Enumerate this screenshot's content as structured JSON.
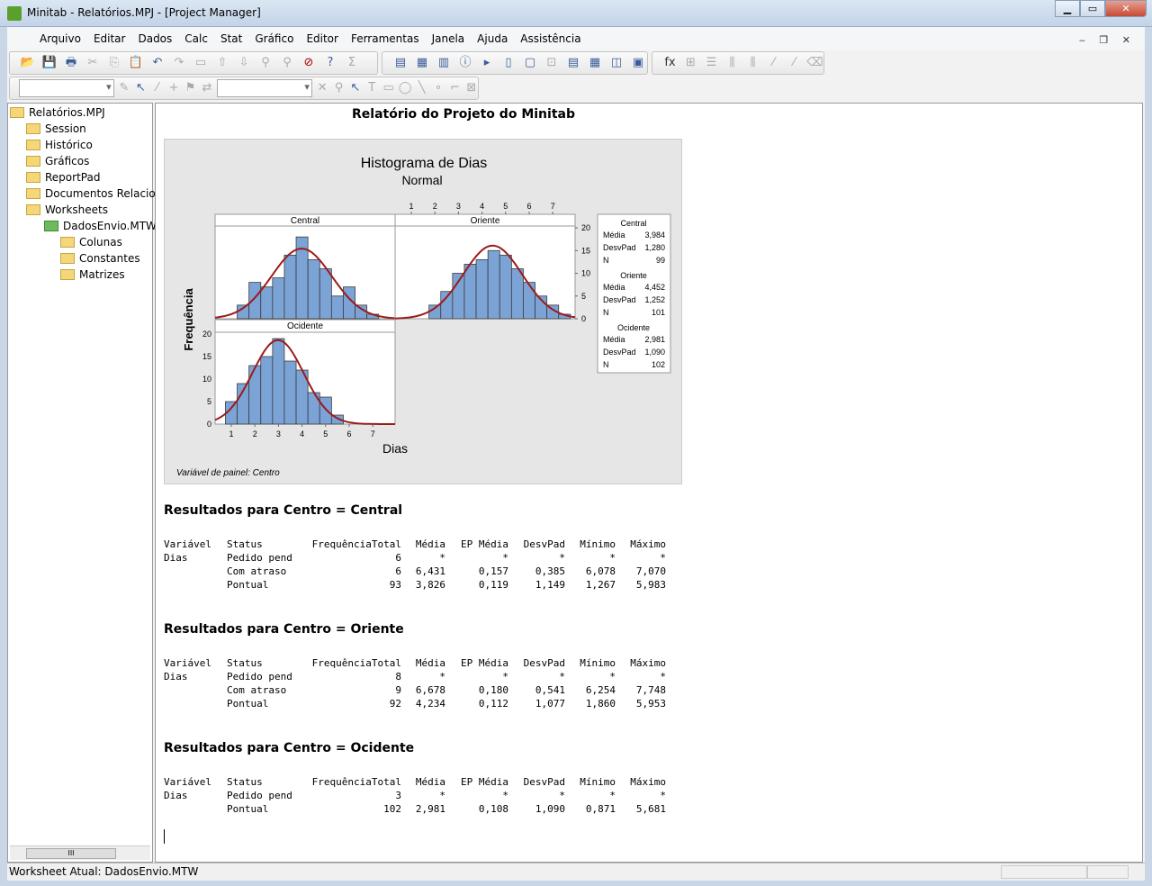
{
  "window": {
    "title": "Minitab - Relatórios.MPJ - [Project Manager]"
  },
  "menu": [
    "Arquivo",
    "Editar",
    "Dados",
    "Calc",
    "Stat",
    "Gráfico",
    "Editor",
    "Ferramentas",
    "Janela",
    "Ajuda",
    "Assistência"
  ],
  "tree": {
    "root": "Relatórios.MPJ",
    "items": [
      "Session",
      "Histórico",
      "Gráficos",
      "ReportPad",
      "Documentos Relacion",
      "Worksheets"
    ],
    "worksheet": "DadosEnvio.MTW",
    "sub": [
      "Colunas",
      "Constantes",
      "Matrizes"
    ]
  },
  "report": {
    "title": "Relatório do Projeto do Minitab"
  },
  "chart_data": {
    "type": "bar",
    "title": "Histograma de Dias",
    "subtitle": "Normal",
    "xlabel": "Dias",
    "ylabel": "Frequência",
    "footnote": "Variável de painel: Centro",
    "x_ticks": [
      "1",
      "2",
      "3",
      "4",
      "5",
      "6",
      "7"
    ],
    "y_ticks": [
      "0",
      "5",
      "10",
      "15",
      "20"
    ],
    "bin_width": 0.5,
    "ylim": [
      0,
      20
    ],
    "xlim": [
      0.3,
      7.9
    ],
    "bar_color": "#7ba3d6",
    "curve_color": "#9b1b1b",
    "panels": [
      {
        "name": "Central",
        "bin_centers": [
          1.5,
          2,
          2.5,
          3,
          3.5,
          4,
          4.5,
          5,
          5.5,
          6,
          6.5,
          7
        ],
        "counts": [
          3,
          8,
          7,
          9,
          14,
          18,
          13,
          11,
          5,
          7,
          3,
          1
        ],
        "stats": {
          "mean_label": "Média",
          "mean": "3,984",
          "sd_label": "DesvPad",
          "sd": "1,280",
          "n_label": "N",
          "n": "99"
        }
      },
      {
        "name": "Oriente",
        "bin_centers": [
          2,
          2.5,
          3,
          3.5,
          4,
          4.5,
          5,
          5.5,
          6,
          6.5,
          7,
          7.5
        ],
        "counts": [
          3,
          6,
          10,
          12,
          13,
          15,
          14,
          11,
          8,
          5,
          3,
          1
        ],
        "stats": {
          "mean_label": "Média",
          "mean": "4,452",
          "sd_label": "DesvPad",
          "sd": "1,252",
          "n_label": "N",
          "n": "101"
        }
      },
      {
        "name": "Ocidente",
        "bin_centers": [
          1,
          1.5,
          2,
          2.5,
          3,
          3.5,
          4,
          4.5,
          5,
          5.5
        ],
        "counts": [
          5,
          9,
          13,
          15,
          19,
          14,
          12,
          7,
          6,
          2
        ],
        "stats": {
          "mean_label": "Média",
          "mean": "2,981",
          "sd_label": "DesvPad",
          "sd": "1,090",
          "n_label": "N",
          "n": "102"
        }
      }
    ]
  },
  "columns": [
    "Variável",
    "Status",
    "FrequênciaTotal",
    "Média",
    "EP Média",
    "DesvPad",
    "Mínimo",
    "Máximo"
  ],
  "sections": [
    {
      "title": "Resultados para Centro = Central",
      "rows": [
        [
          "Dias",
          "Pedido pend",
          "6",
          "*",
          "*",
          "*",
          "*",
          "*"
        ],
        [
          "",
          "Com atraso",
          "6",
          "6,431",
          "0,157",
          "0,385",
          "6,078",
          "7,070"
        ],
        [
          "",
          "Pontual",
          "93",
          "3,826",
          "0,119",
          "1,149",
          "1,267",
          "5,983"
        ]
      ]
    },
    {
      "title": "Resultados para Centro = Oriente",
      "rows": [
        [
          "Dias",
          "Pedido pend",
          "8",
          "*",
          "*",
          "*",
          "*",
          "*"
        ],
        [
          "",
          "Com atraso",
          "9",
          "6,678",
          "0,180",
          "0,541",
          "6,254",
          "7,748"
        ],
        [
          "",
          "Pontual",
          "92",
          "4,234",
          "0,112",
          "1,077",
          "1,860",
          "5,953"
        ]
      ]
    },
    {
      "title": "Resultados para Centro = Ocidente",
      "rows": [
        [
          "Dias",
          "Pedido pend",
          "3",
          "*",
          "*",
          "*",
          "*",
          "*"
        ],
        [
          "",
          "Pontual",
          "102",
          "2,981",
          "0,108",
          "1,090",
          "0,871",
          "5,681"
        ]
      ]
    }
  ],
  "status": {
    "text": "Worksheet Atual: DadosEnvio.MTW"
  }
}
